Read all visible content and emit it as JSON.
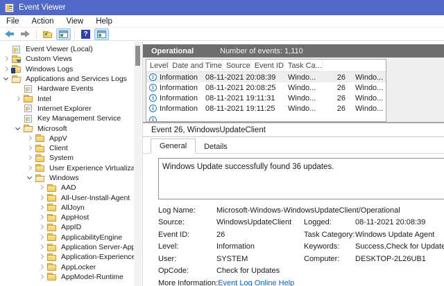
{
  "window": {
    "title": "Event Viewer"
  },
  "menu": {
    "items": [
      {
        "label": "File"
      },
      {
        "label": "Action"
      },
      {
        "label": "View"
      },
      {
        "label": "Help"
      }
    ]
  },
  "toolbar": {
    "buttons": [
      {
        "icon": "back-arrow"
      },
      {
        "icon": "forward-arrow"
      },
      {
        "icon": "folder-up"
      },
      {
        "icon": "console-tree-toggle",
        "active": true
      },
      {
        "icon": "help"
      },
      {
        "icon": "action-pane-toggle",
        "active": true
      }
    ]
  },
  "tree": {
    "items": [
      {
        "label": "Event Viewer (Local)",
        "level": 0,
        "expander": "none",
        "icon": "root"
      },
      {
        "label": "Custom Views",
        "level": 0,
        "expander": "collapsed",
        "icon": "custom-views"
      },
      {
        "label": "Windows Logs",
        "level": 0,
        "expander": "collapsed",
        "icon": "windows-logs"
      },
      {
        "label": "Applications and Services Logs",
        "level": 0,
        "expander": "expanded",
        "icon": "folder-open"
      },
      {
        "label": "Hardware Events",
        "level": 1,
        "expander": "none",
        "icon": "log"
      },
      {
        "label": "Intel",
        "level": 1,
        "expander": "collapsed",
        "icon": "folder"
      },
      {
        "label": "Internet Explorer",
        "level": 1,
        "expander": "none",
        "icon": "log"
      },
      {
        "label": "Key Management Service",
        "level": 1,
        "expander": "none",
        "icon": "log"
      },
      {
        "label": "Microsoft",
        "level": 1,
        "expander": "expanded",
        "icon": "folder-open"
      },
      {
        "label": "AppV",
        "level": 2,
        "expander": "collapsed",
        "icon": "folder"
      },
      {
        "label": "Client",
        "level": 2,
        "expander": "collapsed",
        "icon": "folder"
      },
      {
        "label": "System",
        "level": 2,
        "expander": "collapsed",
        "icon": "folder"
      },
      {
        "label": "User Experience Virtualization",
        "level": 2,
        "expander": "collapsed",
        "icon": "folder"
      },
      {
        "label": "Windows",
        "level": 2,
        "expander": "expanded",
        "icon": "folder-open"
      },
      {
        "label": "AAD",
        "level": 3,
        "expander": "collapsed",
        "icon": "folder"
      },
      {
        "label": "All-User-Install-Agent",
        "level": 3,
        "expander": "collapsed",
        "icon": "folder"
      },
      {
        "label": "AllJoyn",
        "level": 3,
        "expander": "collapsed",
        "icon": "folder"
      },
      {
        "label": "AppHost",
        "level": 3,
        "expander": "collapsed",
        "icon": "folder"
      },
      {
        "label": "AppID",
        "level": 3,
        "expander": "collapsed",
        "icon": "folder"
      },
      {
        "label": "ApplicabilityEngine",
        "level": 3,
        "expander": "collapsed",
        "icon": "folder"
      },
      {
        "label": "Application Server-Applica",
        "level": 3,
        "expander": "collapsed",
        "icon": "folder"
      },
      {
        "label": "Application-Experience",
        "level": 3,
        "expander": "collapsed",
        "icon": "folder"
      },
      {
        "label": "AppLocker",
        "level": 3,
        "expander": "collapsed",
        "icon": "folder"
      },
      {
        "label": "AppModel-Runtime",
        "level": 3,
        "expander": "collapsed",
        "icon": "folder"
      }
    ]
  },
  "list": {
    "title": "Operational",
    "count_label": "Number of events: 1,110",
    "columns": [
      {
        "label": "Level"
      },
      {
        "label": "Date and Time"
      },
      {
        "label": "Source"
      },
      {
        "label": "Event ID"
      },
      {
        "label": "Task Ca..."
      }
    ],
    "rows": [
      {
        "level": "Information",
        "datetime": "08-11-2021 20:08:39",
        "source": "Windo...",
        "event_id": "26",
        "task_category": "Windo...",
        "selected": true
      },
      {
        "level": "Information",
        "datetime": "08-11-2021 20:08:25",
        "source": "Windo...",
        "event_id": "26",
        "task_category": "Windo..."
      },
      {
        "level": "Information",
        "datetime": "08-11-2021 19:11:31",
        "source": "Windo...",
        "event_id": "26",
        "task_category": "Windo..."
      },
      {
        "level": "Information",
        "datetime": "08-11-2021 19:11:25",
        "source": "Windo...",
        "event_id": "26",
        "task_category": "Windo..."
      }
    ]
  },
  "details": {
    "title": "Event 26, WindowsUpdateClient",
    "tabs": [
      {
        "label": "General",
        "active": true
      },
      {
        "label": "Details"
      }
    ],
    "message": "Windows Update successfully found 36 updates.",
    "field_rows": [
      {
        "l_label": "Log Name:",
        "l_value": "Microsoft-Windows-WindowsUpdateClient/Operational",
        "wide": true,
        "r_label": "",
        "r_value": ""
      },
      {
        "l_label": "Source:",
        "l_value": "WindowsUpdateClient",
        "r_label": "Logged:",
        "r_value": "08-11-2021 20:08:39"
      },
      {
        "l_label": "Event ID:",
        "l_value": "26",
        "r_label": "Task Category:",
        "r_value": "Windows Update Agent"
      },
      {
        "l_label": "Level:",
        "l_value": "Information",
        "r_label": "Keywords:",
        "r_value": "Success,Check for Updates"
      },
      {
        "l_label": "User:",
        "l_value": "SYSTEM",
        "r_label": "Computer:",
        "r_value": "DESKTOP-2L26UB1"
      },
      {
        "l_label": "OpCode:",
        "l_value": "Check for Updates",
        "r_label": "",
        "r_value": ""
      }
    ],
    "more_info_label": "More Information:",
    "more_info_link": "Event Log Online Help"
  },
  "colors": {
    "titlebar": "#5069c8",
    "panel_header": "#6e6e6e",
    "link": "#0b5fce",
    "selected_row": "#eeeeee",
    "folder": "#f0cb62",
    "info_icon": "#1d79c7"
  }
}
